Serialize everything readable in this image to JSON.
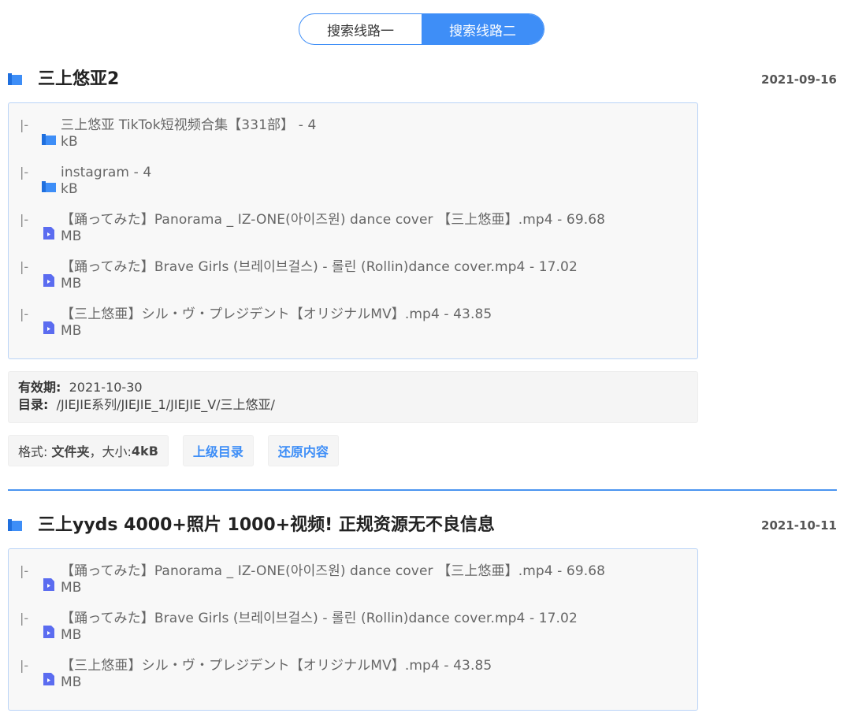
{
  "toggle": {
    "option1": "搜索线路一",
    "option2": "搜索线路二",
    "active": "option2"
  },
  "results": [
    {
      "title": "三上悠亚2",
      "date": "2021-09-16",
      "files": [
        {
          "type": "folder",
          "name": "三上悠亚 TikTok短视频合集【331部】 - 4",
          "size": "kB"
        },
        {
          "type": "folder",
          "name": "instagram - 4",
          "size": "kB"
        },
        {
          "type": "video",
          "name": "【踊ってみた】Panorama _ IZ-ONE(아이즈원) dance cover 【三上悠亜】.mp4 - 69.68",
          "size": "MB"
        },
        {
          "type": "video",
          "name": "【踊ってみた】Brave Girls (브레이브걸스) - 롤린 (Rollin)dance cover.mp4 - 17.02",
          "size": "MB"
        },
        {
          "type": "video",
          "name": "【三上悠亜】シル・ヴ・プレジデント【オリジナルMV】.mp4 - 43.85",
          "size": "MB"
        }
      ],
      "validity_label": "有效期:",
      "validity_value": "2021-10-30",
      "dir_label": "目录:",
      "dir_value": "/JIEJIE系列/JIEJIE_1/JIEJIE_V/三上悠亚/",
      "format_label": "格式:",
      "format_value": "文件夹",
      "size_sep": "，大小:",
      "size_value": "4kB",
      "parent_btn": "上级目录",
      "restore_btn": "还原内容"
    },
    {
      "title": "三上yyds 4000+照片 1000+视频! 正规资源无不良信息",
      "date": "2021-10-11",
      "files": [
        {
          "type": "video",
          "name": "【踊ってみた】Panorama _ IZ-ONE(아이즈원) dance cover 【三上悠亜】.mp4 - 69.68",
          "size": "MB"
        },
        {
          "type": "video",
          "name": "【踊ってみた】Brave Girls (브레이브걸스) - 롤린 (Rollin)dance cover.mp4 - 17.02",
          "size": "MB"
        },
        {
          "type": "video",
          "name": "【三上悠亜】シル・ヴ・プレジデント【オリジナルMV】.mp4 - 43.85",
          "size": "MB"
        }
      ]
    }
  ],
  "tree_prefix": "|-",
  "colors": {
    "accent": "#3e8ef7",
    "border": "#b9d3f7"
  }
}
